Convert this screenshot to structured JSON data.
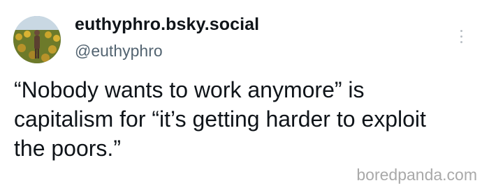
{
  "post": {
    "display_name": "euthyphro.bsky.social",
    "handle": "@euthyphro",
    "text": "“Nobody wants to work anymore” is capitalism for “it’s getting harder to exploit the poors.”",
    "more_icon": "vertical-ellipsis-icon"
  },
  "watermark": {
    "text": "boredpanda.com"
  },
  "colors": {
    "text": "#0f1419",
    "handle": "#536471",
    "watermark": "#a9a9a9"
  }
}
